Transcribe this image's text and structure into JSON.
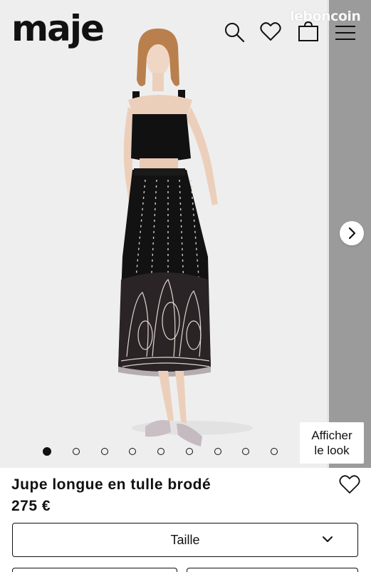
{
  "header": {
    "logo": "maje",
    "watermark": "leboncoin",
    "icons": [
      "search-icon",
      "heart-icon",
      "bag-icon",
      "menu-icon"
    ]
  },
  "gallery": {
    "dot_count": 9,
    "active_index": 0,
    "look_button": {
      "line1": "Afficher",
      "line2": "le look"
    },
    "next_icon": "chevron-right-icon"
  },
  "product": {
    "title": "Jupe longue en tulle brodé",
    "price": "275 €",
    "size_label": "Taille"
  },
  "colors": {
    "background": "#eeeeee",
    "text": "#111111",
    "next_panel": "#9b9b9b"
  }
}
